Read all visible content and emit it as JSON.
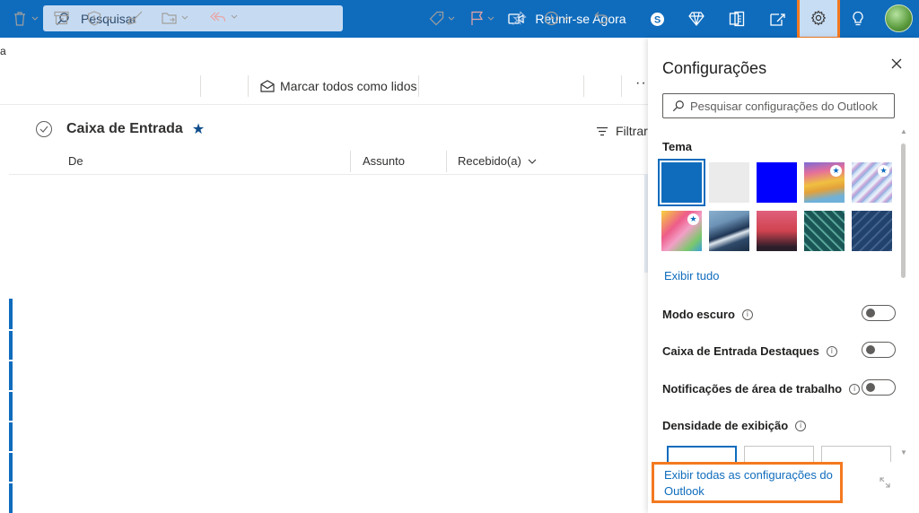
{
  "header": {
    "search_placeholder": "Pesquisar",
    "meet_label": "Reunir-se Agora",
    "icons": [
      "skype-icon",
      "diamond-icon",
      "office-icon",
      "whats-new-icon",
      "gear-icon",
      "lightbulb-icon"
    ]
  },
  "left_strip": {
    "cut_text": "a"
  },
  "toolbar": {
    "mark_all_read": "Marcar todos como lidos",
    "more": "···"
  },
  "mail_list": {
    "folder_title": "Caixa de Entrada",
    "filter_label": "Filtrar",
    "columns": [
      "De",
      "Assunto",
      "Recebido(a)"
    ]
  },
  "settings": {
    "title": "Configurações",
    "search_placeholder": "Pesquisar configurações do Outlook",
    "theme_label": "Tema",
    "themes": [
      {
        "name": "azul",
        "color": "#0f6cbd",
        "selected": true,
        "premium": false
      },
      {
        "name": "cinza",
        "color": "#ebebeb",
        "selected": false,
        "premium": false
      },
      {
        "name": "azul-vivo",
        "color": "#0000ff",
        "selected": false,
        "premium": false
      },
      {
        "name": "arco-iris",
        "color": "#d9a43a",
        "selected": false,
        "premium": true
      },
      {
        "name": "linhas",
        "color": "#a9c3e6",
        "selected": false,
        "premium": true
      },
      {
        "name": "colorido",
        "color": "#e9567b",
        "selected": false,
        "premium": true
      },
      {
        "name": "onda",
        "color": "#35506f",
        "selected": false,
        "premium": false
      },
      {
        "name": "por-do-sol",
        "color": "#d45a5a",
        "selected": false,
        "premium": false
      },
      {
        "name": "circuito",
        "color": "#1e5a5a",
        "selected": false,
        "premium": false
      },
      {
        "name": "inovacao",
        "color": "#1f3f6b",
        "selected": false,
        "premium": false
      }
    ],
    "show_all": "Exibir tudo",
    "dark_mode": "Modo escuro",
    "focused_inbox": "Caixa de Entrada Destaques",
    "desktop_notifications": "Notificações de área de trabalho",
    "density_label": "Densidade de exibição",
    "toggles": {
      "dark_mode": false,
      "focused_inbox": false,
      "desktop_notifications": false
    },
    "view_all_settings": "Exibir todas as configurações do Outlook"
  }
}
